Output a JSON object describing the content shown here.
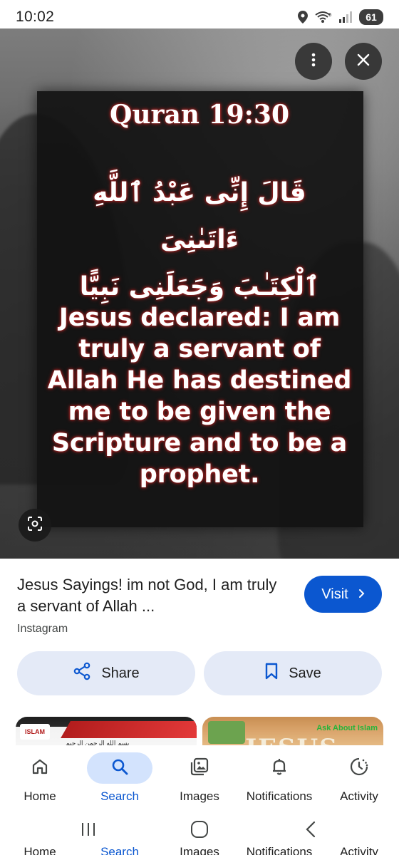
{
  "status_bar": {
    "time": "10:02",
    "battery": "61",
    "icons": [
      "location-icon",
      "wifi-6-icon",
      "signal-icon",
      "battery-icon"
    ]
  },
  "viewer": {
    "image": {
      "reference": "Quran 19:30",
      "arabic_line1": "قَالَ إِنِّى عَبْدُ ٱللَّهِ ءَاتَىٰنِىَ",
      "arabic_line2": "ٱلْكِتَـٰبَ وَجَعَلَنِى نَبِيًّا",
      "english_line1": "Jesus declared: I am",
      "english_line2": "truly a servant of",
      "english_line3": "Allah He has destined",
      "english_line4": "me to be given the",
      "english_line5": "Scripture and to be a",
      "english_line6": "prophet."
    },
    "more_icon": "more-vert-icon",
    "close_icon": "close-icon",
    "lens_icon": "lens-icon"
  },
  "result": {
    "title": "Jesus Sayings! im not God, I am truly a servant of Allah ...",
    "source": "Instagram",
    "visit_label": "Visit",
    "share_label": "Share",
    "save_label": "Save"
  },
  "related": {
    "left": {
      "logo_text": "ISLAM",
      "line_text": "بسم الله الرحمن الرحيم"
    },
    "right": {
      "tag_text": "Ask About Islam",
      "big_text": "JESUS"
    }
  },
  "bottom_nav": {
    "items": [
      {
        "label": "Home",
        "icon": "home-icon"
      },
      {
        "label": "Search",
        "icon": "search-icon"
      },
      {
        "label": "Images",
        "icon": "images-icon"
      },
      {
        "label": "Notifications",
        "icon": "bell-icon"
      },
      {
        "label": "Activity",
        "icon": "activity-icon"
      }
    ],
    "active": "Search"
  },
  "colors": {
    "accent": "#0b57d0",
    "pill_bg": "#e4eaf7",
    "active_nav_bg": "#d3e3fd"
  }
}
